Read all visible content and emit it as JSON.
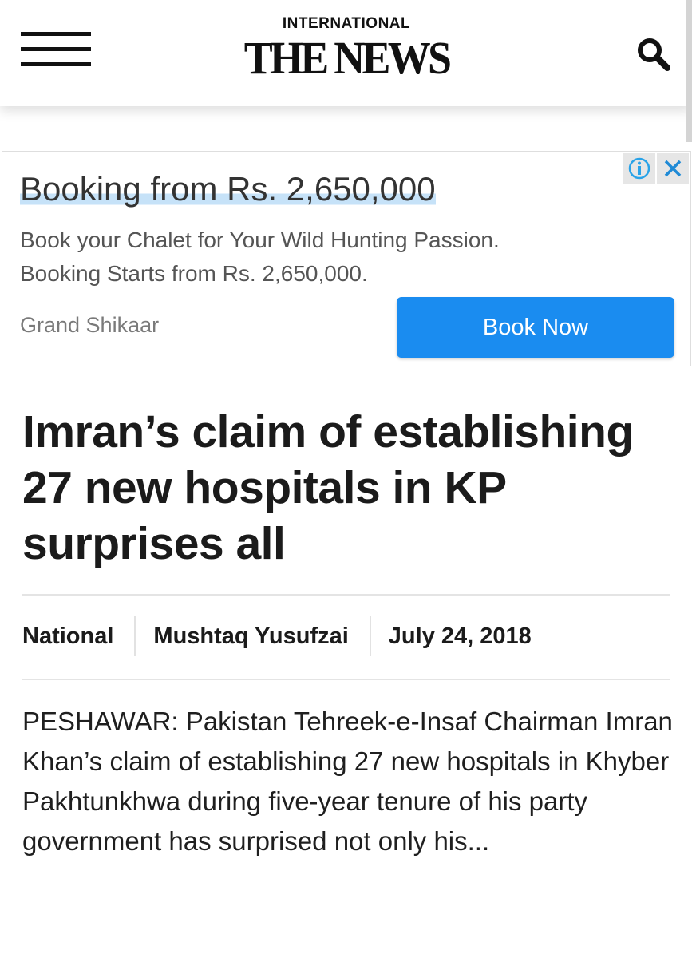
{
  "header": {
    "logo_top": "INTERNATIONAL",
    "logo_main": "THE NEWS",
    "menu_icon": "hamburger-menu-icon",
    "search_icon": "search-icon"
  },
  "ad": {
    "headline": "Booking from Rs. 2,650,000",
    "desc_line1": "Book your Chalet for Your Wild Hunting Passion.",
    "desc_line2": "Booking Starts from Rs. 2,650,000.",
    "advertiser": "Grand Shikaar",
    "cta": "Book Now",
    "info_icon": "info-icon",
    "close_icon": "close-icon",
    "cta_color": "#1a8cf0"
  },
  "article": {
    "headline": "Imran’s claim of establishing 27 new hospitals in KP surprises all",
    "category": "National",
    "author": "Mushtaq Yusufzai",
    "date": "July 24, 2018",
    "excerpt": "PESHAWAR: Pakistan Tehreek-e-Insaf Chairman Imran Khan’s claim of establishing 27 new hospitals in Khyber Pakhtunkhwa during five-year tenure of his party government has surprised not only his..."
  }
}
